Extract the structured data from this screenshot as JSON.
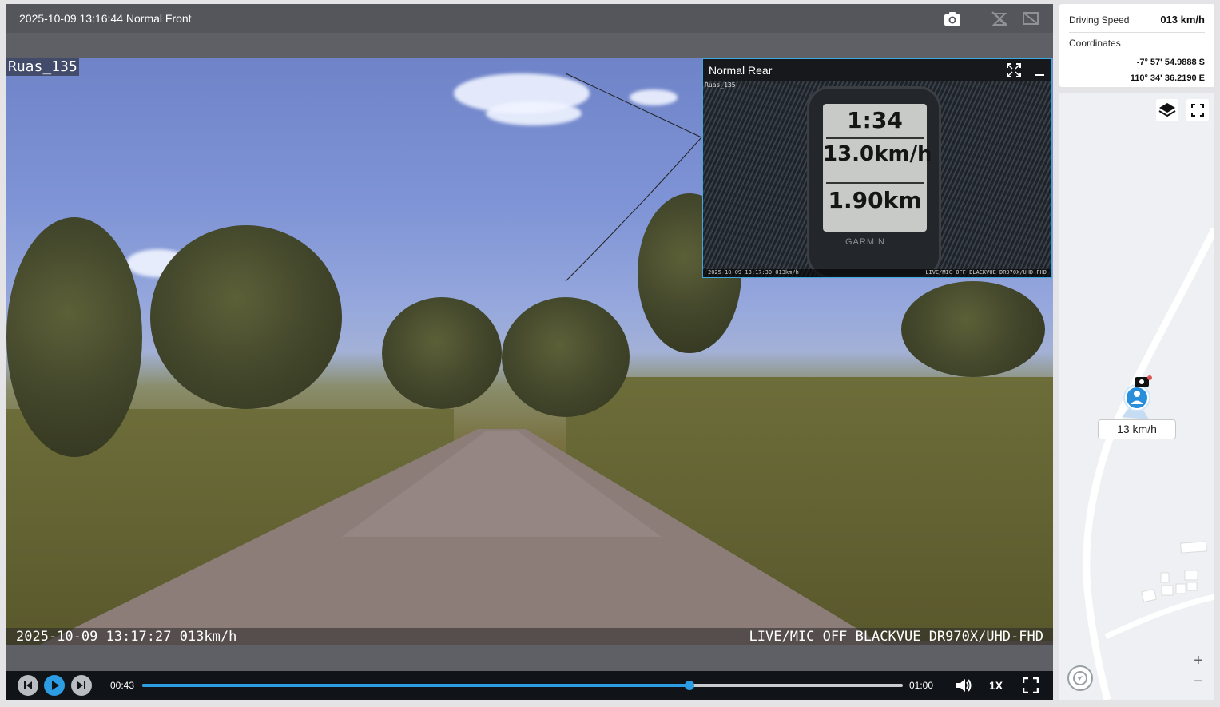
{
  "player": {
    "title": "2025-10-09 13:16:44 Normal Front",
    "icons": {
      "camera": "camera-icon",
      "mute": "mic-off-icon",
      "cam_off": "camera-off-icon"
    },
    "overlay": {
      "name": "Ruas_135",
      "timestamp": "2025-10-09 13:17:27 013km/h",
      "model": "LIVE/MIC OFF BLACKVUE DR970X/UHD-FHD"
    },
    "rear": {
      "title": "Normal Rear",
      "tag": "Ruas_135",
      "gps_line1": "1:34",
      "gps_line2": "13.0km/h",
      "gps_line3": "1.90km",
      "gps_brand": "GARMIN",
      "foot_left": "2025-10-09 13:17:30 013km/h",
      "foot_right": "LIVE/MIC OFF BLACKVUE DR970X/UHD-FHD"
    },
    "controls": {
      "time_current": "00:43",
      "time_end": "01:00",
      "progress": 0.72,
      "speed": "1X"
    }
  },
  "info": {
    "speed_label": "Driving Speed",
    "speed_value": "013 km/h",
    "coord_label": "Coordinates",
    "lat": "-7° 57' 54.9888 S",
    "lon": "110° 34' 36.2190 E"
  },
  "map": {
    "marker_speed": "13 km/h",
    "zoom_in": "+",
    "zoom_out": "−"
  },
  "colors": {
    "accent": "#2d9de3",
    "panel": "#5f5f66",
    "controls": "#101418"
  }
}
